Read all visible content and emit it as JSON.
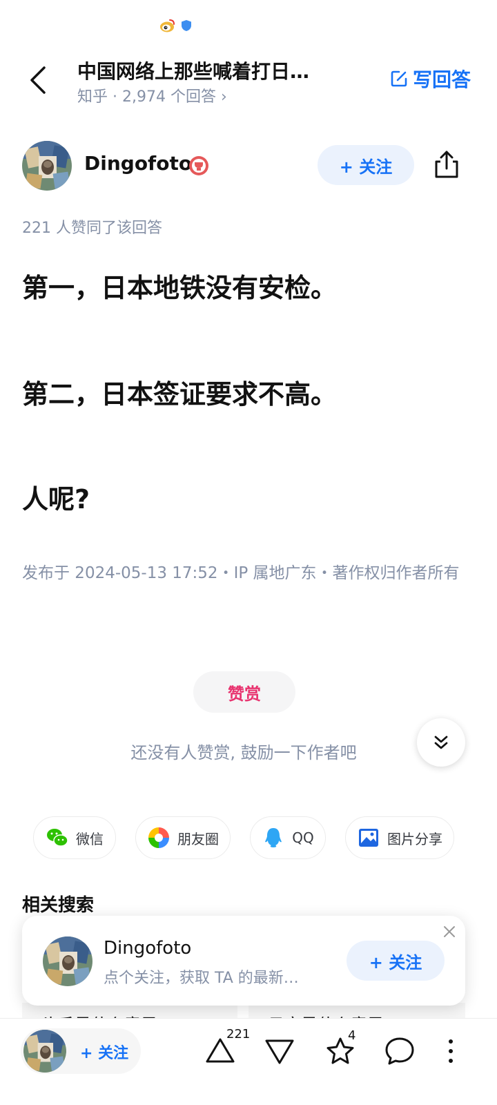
{
  "question": {
    "title": "中国网络上那些喊着打日…",
    "meta": "知乎 · 2,974 个回答 ›"
  },
  "header": {
    "write_answer_label": "写回答"
  },
  "author": {
    "name": "Dingofoto",
    "follow_label": "+ 关注"
  },
  "answer": {
    "upvote_text": "221 人赞同了该回答",
    "paragraphs": [
      "第一，日本地铁没有安检。",
      "第二，日本签证要求不高。",
      "人呢?"
    ],
    "publish_info": "发布于 2024-05-13 17:52・IP 属地广东・著作权归作者所有"
  },
  "reward": {
    "button_label": "赞赏",
    "hint": "还没有人赞赏, 鼓励一下作者吧"
  },
  "share": {
    "wechat": "微信",
    "moments": "朋友圈",
    "qq": "QQ",
    "image": "图片分享"
  },
  "related": {
    "title": "相关搜索",
    "items": [
      "头香是什么意思",
      "日寇是什么意思"
    ]
  },
  "follow_card": {
    "name": "Dingofoto",
    "description": "点个关注，获取 TA 的最新…",
    "follow_label": "+ 关注"
  },
  "bottom_bar": {
    "follow_label": "+ 关注",
    "upvote_count": "221",
    "favorite_count": "4"
  },
  "colors": {
    "accent": "#1772f6",
    "reward": "#e8336f",
    "muted": "#8590a6"
  },
  "icons": [
    "weibo-icon",
    "shield-icon",
    "back-icon",
    "edit-icon",
    "badge-icon",
    "share-icon",
    "chevron-down-icon",
    "wechat-icon",
    "moments-icon",
    "qq-icon",
    "image-icon",
    "close-icon",
    "upvote-icon",
    "downvote-icon",
    "star-icon",
    "comment-icon",
    "more-icon"
  ]
}
